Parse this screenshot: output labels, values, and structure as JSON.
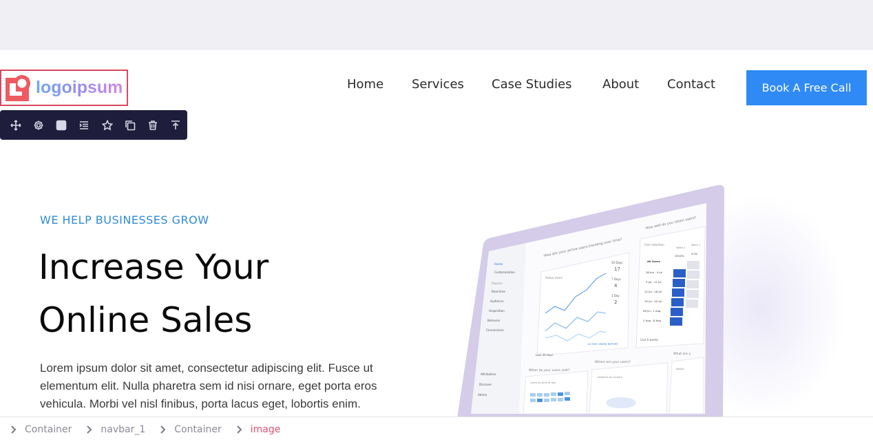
{
  "header": {
    "logo_text": "logoipsum",
    "nav": [
      "Home",
      "Services",
      "Case Studies",
      "About",
      "Contact"
    ],
    "cta_label": "Book A Free Call"
  },
  "toolbar": {
    "icons": [
      "move-icon",
      "settings-icon",
      "style-icon",
      "navigator-icon",
      "favorite-icon",
      "duplicate-icon",
      "delete-icon",
      "move-up-icon"
    ]
  },
  "hero": {
    "eyebrow": "WE HELP BUSINESSES GROW",
    "headline_line1": "Increase Your",
    "headline_line2": "Online Sales",
    "body": "Lorem ipsum dolor sit amet, consectetur adipiscing elit. Fusce ut elementum elit. Nulla pharetra sem id nisi ornare, eget porta eros vehicula. Morbi vel nisl finibus, porta lacus eget, lobortis enim."
  },
  "dashboard": {
    "sidebar_items": [
      "Home",
      "Customization",
      "Reports",
      "Real-time",
      "Audience",
      "Acquisition",
      "Behavior",
      "Conversions",
      "Attribution",
      "Discover",
      "Admin"
    ],
    "active_users_title": "How are your active users trending over time?",
    "active_users_label": "Active Users",
    "metrics": [
      {
        "label": "30 Days",
        "value": "17"
      },
      {
        "label": "7 Days",
        "value": "4"
      },
      {
        "label": "1 Day",
        "value": "2"
      }
    ],
    "report_link": "ACTIVE USERS REPORT",
    "retention_title": "How well do you retain users?",
    "retention_label": "User retention",
    "retention_cols": [
      "Week 0",
      "Week 1"
    ],
    "retention_rows": [
      "All Users",
      "28 Jun - 4 Jul",
      "5 Jul - 11 Jul",
      "12 Jul - 18 Jul",
      "19 Jul - 25 Jul",
      "26 Jul - 1 Aug",
      "2 Aug - 8 Aug"
    ],
    "retention_values": [
      "100.0%",
      "0.0%"
    ],
    "footer_left": "Last 30 days",
    "footer_right": "Last 6 weeks",
    "visit_title": "When do your users visit?",
    "visit_sub": "Users by time of day",
    "where_title": "Where are your users?",
    "where_sub": "Sessions by country",
    "what_title": "What are y",
    "sessions_label": "Sessio"
  },
  "breadcrumbs": [
    "Container",
    "navbar_1",
    "Container",
    "image"
  ],
  "colors": {
    "accent": "#2f8af5",
    "toolbar_bg": "#1e1e3c",
    "selection": "#d9485f",
    "eyebrow": "#2f8ad8",
    "laptop_frame": "#d4cce8"
  }
}
